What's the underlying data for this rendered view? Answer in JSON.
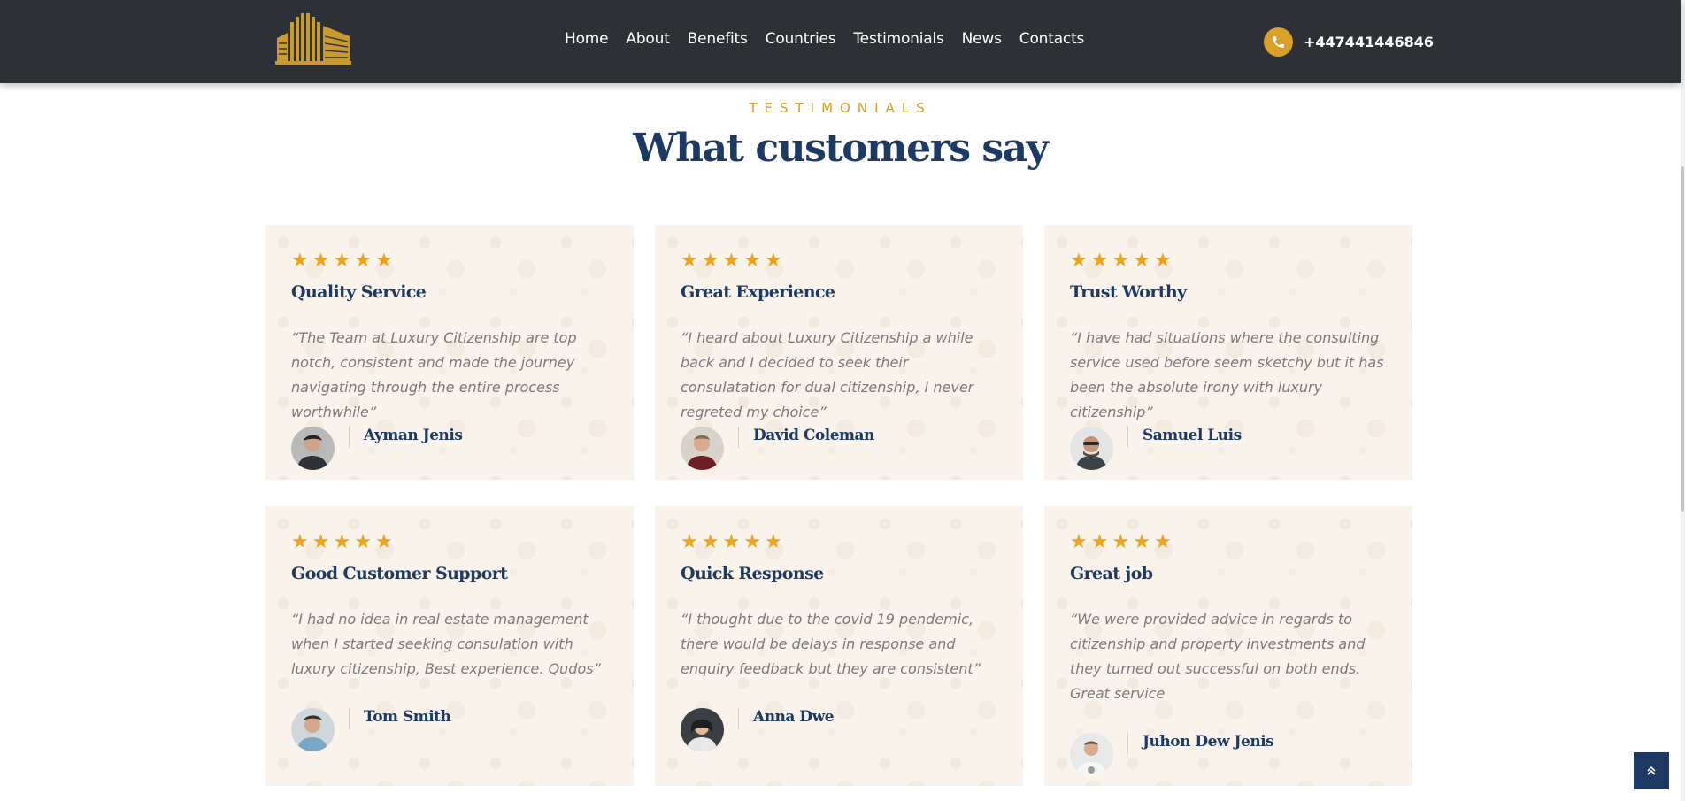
{
  "header": {
    "nav": [
      "Home",
      "About",
      "Benefits",
      "Countries",
      "Testimonials",
      "News",
      "Contacts"
    ],
    "phone": "+447441446846"
  },
  "section": {
    "eyebrow": "TESTIMONIALS",
    "heading": "What customers say"
  },
  "testimonials": [
    {
      "rating": 5,
      "title": "Quality Service",
      "quote": "“The Team at Luxury Citizenship are top notch, consistent and made the journey navigating through the entire process worthwhile”",
      "author": "Ayman Jenis"
    },
    {
      "rating": 5,
      "title": "Great Experience",
      "quote": "“I heard about Luxury Citizenship a while back and I decided to seek their consulatation for dual citizenship, I never regreted my choice”",
      "author": "David Coleman"
    },
    {
      "rating": 5,
      "title": "Trust Worthy",
      "quote": "“I have had situations where the consulting service used before seem sketchy but it has been the absolute irony with luxury citizenship”",
      "author": "Samuel Luis"
    },
    {
      "rating": 5,
      "title": "Good Customer Support",
      "quote": "“I had no idea in real estate management when I started seeking consulation with luxury citizenship, Best experience. Qudos”",
      "author": "Tom Smith"
    },
    {
      "rating": 5,
      "title": "Quick Response",
      "quote": "“I thought due to the covid 19 pendemic, there would be delays in response and enquiry feedback but they are consistent”",
      "author": "Anna Dwe"
    },
    {
      "rating": 5,
      "title": "Great job",
      "quote": "“We were provided advice in regards to citizenship and property investments and they turned out successful on both ends. Great service",
      "author": "Juhon Dew Jenis"
    }
  ],
  "colors": {
    "header_bg": "#2d3135",
    "accent_gold": "#d9a02a",
    "star": "#f0a21a",
    "navy": "#1c3a63",
    "card_bg": "#f9f3ec"
  },
  "icons": [
    "building-logo-icon",
    "phone-icon",
    "star-icon",
    "avatar",
    "chevron-up-double-icon"
  ]
}
